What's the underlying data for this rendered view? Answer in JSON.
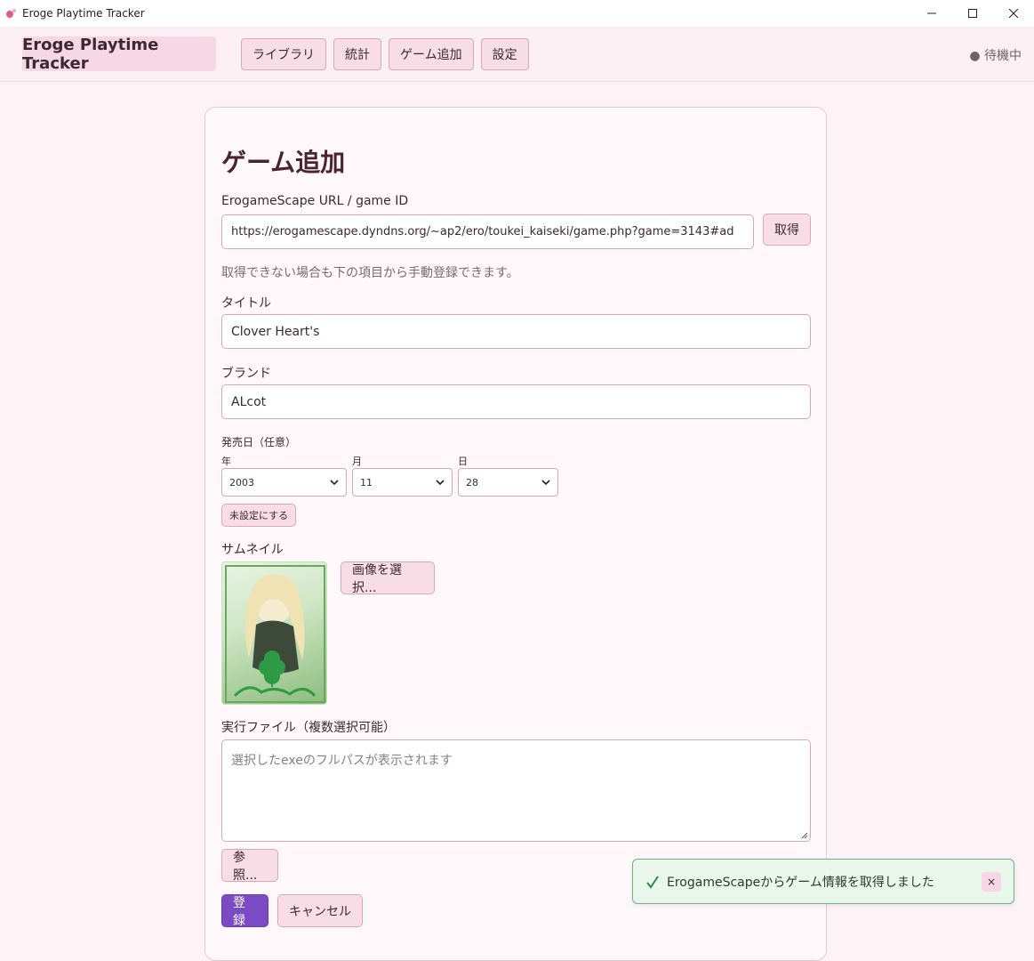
{
  "window": {
    "title": "Eroge Playtime Tracker"
  },
  "header": {
    "brand": "Eroge Playtime Tracker",
    "nav": [
      "ライブラリ",
      "統計",
      "ゲーム追加",
      "設定"
    ],
    "status": "● 待機中"
  },
  "form": {
    "page_title": "ゲーム追加",
    "url_label": "ErogameScape URL / game ID",
    "url_value": "https://erogamescape.dyndns.org/~ap2/ero/toukei_kaiseki/game.php?game=3143#ad",
    "fetch_button": "取得",
    "hint": "取得できない場合も下の項目から手動登録できます。",
    "title_label": "タイトル",
    "title_value": "Clover Heart's",
    "brand_label": "ブランド",
    "brand_value": "ALcot",
    "release_label": "発売日（任意）",
    "year_label": "年",
    "year_value": "2003",
    "month_label": "月",
    "month_value": "11",
    "day_label": "日",
    "day_value": "28",
    "unset_button": "未設定にする",
    "thumbnail_label": "サムネイル",
    "select_image_button": "画像を選択...",
    "exe_label": "実行ファイル（複数選択可能）",
    "exe_placeholder": "選択したexeのフルパスが表示されます",
    "browse_button": "参照...",
    "register_button": "登録",
    "cancel_button": "キャンセル"
  },
  "toast": {
    "message": "ErogameScapeからゲーム情報を取得しました",
    "close": "×"
  },
  "colors": {
    "accent": "#7b4bc5",
    "button_bg": "#f8dce6",
    "toast_border": "#6fb17f"
  }
}
